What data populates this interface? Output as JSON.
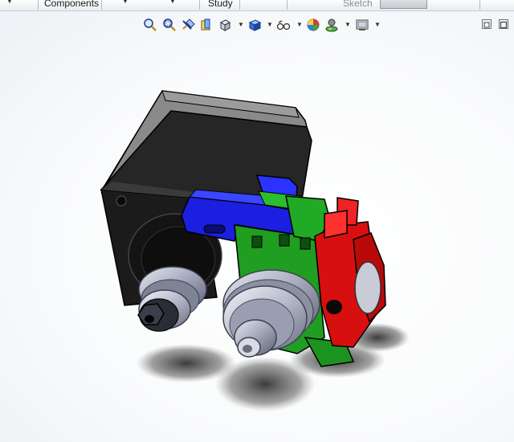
{
  "tabs": {
    "components": "Components",
    "study": "Study",
    "sketch": "Sketch"
  },
  "view_toolbar": {
    "icons": [
      "zoom-to-fit-icon",
      "zoom-to-area-icon",
      "previous-view-icon",
      "section-view-icon",
      "view-orientation-icon",
      "display-style-icon",
      "hide-show-items-icon",
      "edit-appearance-icon",
      "apply-scene-icon",
      "view-settings-icon"
    ]
  },
  "colors": {
    "motor_body": "#1e1e1e",
    "motor_top": "#8c8c8c",
    "bracket_blue": "#1f24e6",
    "plate_green": "#22a126",
    "arm_red": "#e01010",
    "pulley_steel": "#9aa0b4"
  }
}
